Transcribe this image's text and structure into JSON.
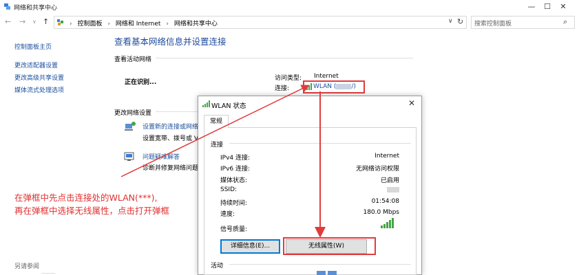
{
  "window": {
    "title": "网络和共享中心",
    "minimize_icon": "minimize-icon",
    "maximize_icon": "maximize-icon",
    "close_icon": "close-icon"
  },
  "address_bar": {
    "breadcrumbs": [
      "控制面板",
      "网络和 Internet",
      "网络和共享中心"
    ],
    "search_placeholder": "搜索控制面板"
  },
  "sidebar": {
    "items": [
      {
        "label": "控制面板主页"
      },
      {
        "label": "更改适配器设置"
      },
      {
        "label": "更改高级共享设置"
      },
      {
        "label": "媒体流式处理选项"
      }
    ],
    "see_also": "另请参阅"
  },
  "main": {
    "title": "查看基本网络信息并设置连接",
    "active_networks_label": "查看活动网络",
    "network_status": "正在识别...",
    "access_type_label": "访问类型:",
    "access_type_value": "Internet",
    "connection_label": "连接:",
    "connection_value": "WLAN (",
    "connection_value_suffix": "/)",
    "change_settings_label": "更改网络设置",
    "settings": [
      {
        "link": "设置新的连接或网络",
        "desc": "设置宽带、拨号或 V"
      },
      {
        "link": "问题疑难解答",
        "desc": "诊断并修复网络问题"
      }
    ]
  },
  "instruction": {
    "line1": "在弹框中先点击连接处的WLAN(***),",
    "line2": "再在弹框中选择无线属性，点击打开弹框"
  },
  "dialog": {
    "title": "WLAN 状态",
    "tab": "常规",
    "connection_group": "连接",
    "rows": [
      {
        "key": "IPv4 连接:",
        "value": "Internet"
      },
      {
        "key": "IPv6 连接:",
        "value": "无网络访问权限"
      },
      {
        "key": "媒体状态:",
        "value": "已启用"
      },
      {
        "key": "SSID:",
        "value": ""
      },
      {
        "key": "持续时间:",
        "value": "01:54:08"
      },
      {
        "key": "速度:",
        "value": "180.0 Mbps"
      }
    ],
    "signal_label": "信号质量:",
    "details_button": "详细信息(E)...",
    "wireless_props_button": "无线属性(W)",
    "activity_group": "活动"
  },
  "colors": {
    "link": "#1a4f9c",
    "annotation": "#e03c3c",
    "title": "#1e4a9c"
  }
}
